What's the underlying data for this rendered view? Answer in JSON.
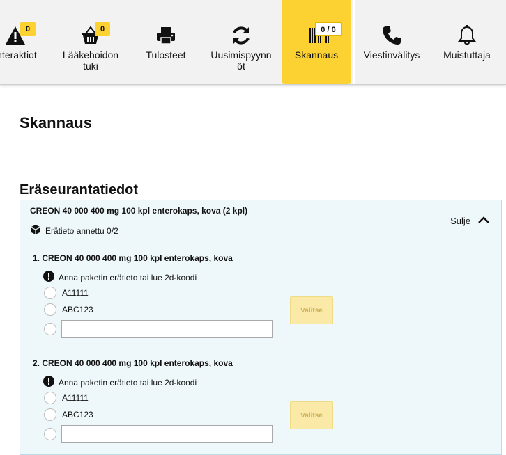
{
  "nav": {
    "items": [
      {
        "label": "Interaktiot",
        "icon": "warning-icon",
        "badge": "0"
      },
      {
        "label": "Lääkehoidon\ntuki",
        "icon": "basket-icon",
        "badge": "0"
      },
      {
        "label": "Tulosteet",
        "icon": "printer-icon"
      },
      {
        "label": "Uusimispyynn\nöt",
        "icon": "refresh-icon"
      },
      {
        "label": "Skannaus",
        "icon": "barcode-icon",
        "badge": "0 / 0",
        "active": true
      },
      {
        "label": "Viestinvälitys",
        "icon": "phone-icon"
      },
      {
        "label": "Muistuttaja",
        "icon": "bell-icon"
      }
    ]
  },
  "page": {
    "title": "Skannaus",
    "section_title": "Eräseurantatiedot"
  },
  "panel": {
    "product": "CREON 40 000 400 mg 100 kpl enterokaps, kova (2 kpl)",
    "status": "Erätieto annettu 0/2",
    "toggle_label": "Sulje",
    "items": [
      {
        "title": "1. CREON 40 000 400 mg 100 kpl enterokaps, kova",
        "warning": "Anna paketin erätieto tai lue 2d-koodi",
        "options": [
          "A11111",
          "ABC123"
        ],
        "input_value": "",
        "button": "Valitse"
      },
      {
        "title": "2. CREON 40 000 400 mg 100 kpl enterokaps, kova",
        "warning": "Anna paketin erätieto tai lue 2d-koodi",
        "options": [
          "A11111",
          "ABC123"
        ],
        "input_value": "",
        "button": "Valitse"
      }
    ]
  },
  "colors": {
    "accent": "#fcd232",
    "panel_bg": "#eef7fa",
    "panel_border": "#b7dcea",
    "button_disabled_bg": "#fbe9a8"
  }
}
